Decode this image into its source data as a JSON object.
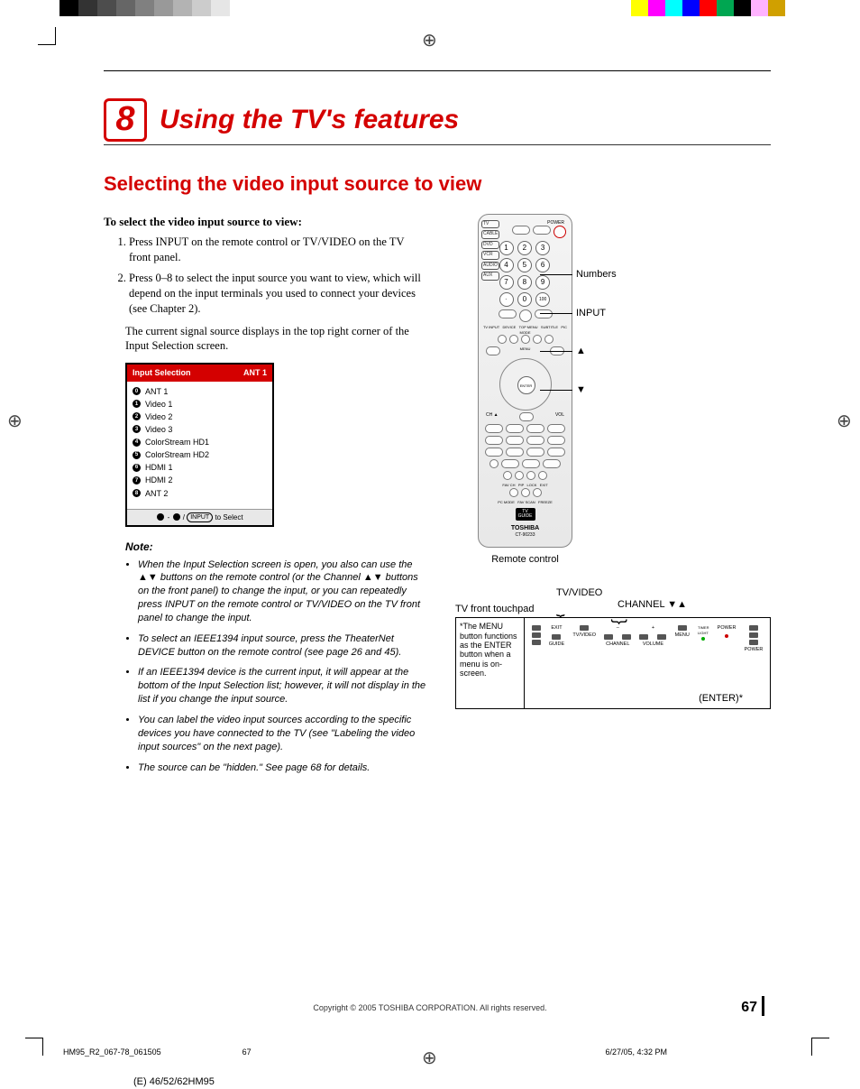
{
  "chapter": {
    "number": "8",
    "title": "Using the TV's features"
  },
  "section_title": "Selecting the video input source to view",
  "intro": "To select the video input source to view:",
  "steps": [
    "Press INPUT on the remote control or TV/VIDEO on the TV front panel.",
    "Press 0–8 to select the input source you want to view, which will depend on the input terminals you used to connect your devices (see Chapter 2)."
  ],
  "paragraph": "The current signal source displays in the top right corner of the Input Selection screen.",
  "input_selection": {
    "title": "Input Selection",
    "current": "ANT 1",
    "items": [
      {
        "n": "0",
        "label": "ANT 1"
      },
      {
        "n": "1",
        "label": "Video 1"
      },
      {
        "n": "2",
        "label": "Video 2"
      },
      {
        "n": "3",
        "label": "Video 3"
      },
      {
        "n": "4",
        "label": "ColorStream HD1"
      },
      {
        "n": "5",
        "label": "ColorStream HD2"
      },
      {
        "n": "6",
        "label": "HDMI 1"
      },
      {
        "n": "7",
        "label": "HDMI 2"
      },
      {
        "n": "8",
        "label": "ANT 2"
      }
    ],
    "footer_pill": "INPUT",
    "footer_text": "to Select"
  },
  "note_head": "Note:",
  "notes": [
    "When the Input Selection screen is open, you also can use the ▲▼ buttons on the remote control (or the Channel ▲▼ buttons on the front panel) to change the input, or you can repeatedly press INPUT on the remote control or TV/VIDEO on the TV front panel to change the input.",
    "To select an IEEE1394 input source, press the TheaterNet DEVICE button on the remote control (see page 26 and 45).",
    "If an IEEE1394 device is the current input, it will appear at the bottom of the Input Selection list; however, it will not display in the list if you change the input source.",
    "You can label the video input sources according to the specific devices you have connected to the TV (see \"Labeling the video input sources\" on the next page).",
    "The source can be \"hidden.\" See page 68 for details."
  ],
  "remote": {
    "caption": "Remote control",
    "brand": "TOSHIBA",
    "model": "CT-90233",
    "callouts": {
      "numbers": "Numbers",
      "input": "INPUT",
      "up": "▲",
      "down": "▼"
    },
    "enter": "ENTER",
    "tvguide": {
      "l1": "TV",
      "l2": "GUIDE"
    }
  },
  "front_panel": {
    "tv_video": "TV/VIDEO",
    "channel": "CHANNEL ▼▲",
    "touchpad": "TV front touchpad",
    "side_note": "*The MENU button functions as the ENTER button when a menu is on-screen.",
    "enter_note": "(ENTER)*",
    "labels": [
      "EXIT",
      "GUIDE",
      "TV/VIDEO",
      "CHANNEL",
      "VOLUME",
      "MENU",
      "TIMER",
      "POWER",
      "TIMER LIGHT",
      "POWER"
    ]
  },
  "footer": {
    "copyright": "Copyright © 2005 TOSHIBA CORPORATION. All rights reserved.",
    "page": "67",
    "slug_file": "HM95_R2_067-78_061505",
    "slug_page": "67",
    "slug_date": "6/27/05, 4:32 PM",
    "model": "(E) 46/52/62HM95"
  },
  "colorbars": {
    "left": [
      "#000000",
      "#333333",
      "#4d4d4d",
      "#666666",
      "#808080",
      "#999999",
      "#b3b3b3",
      "#cccccc",
      "#e6e6e6",
      "#ffffff"
    ],
    "right": [
      "#ffff00",
      "#ff00ff",
      "#00ffff",
      "#0000ff",
      "#ff0000",
      "#00a651",
      "#000000",
      "#ffb3ff",
      "#d0a000",
      "#ffffff"
    ]
  }
}
